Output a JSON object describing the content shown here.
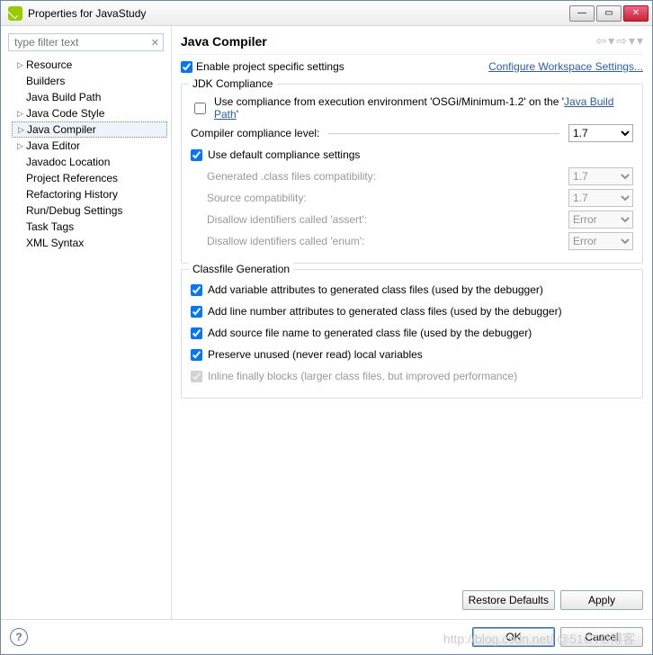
{
  "window": {
    "title": "Properties for JavaStudy"
  },
  "filter": {
    "placeholder": "type filter text"
  },
  "tree": [
    {
      "label": "Resource",
      "arrow": "▷"
    },
    {
      "label": "Builders",
      "arrow": ""
    },
    {
      "label": "Java Build Path",
      "arrow": ""
    },
    {
      "label": "Java Code Style",
      "arrow": "▷"
    },
    {
      "label": "Java Compiler",
      "arrow": "▷",
      "selected": true
    },
    {
      "label": "Java Editor",
      "arrow": "▷"
    },
    {
      "label": "Javadoc Location",
      "arrow": ""
    },
    {
      "label": "Project References",
      "arrow": ""
    },
    {
      "label": "Refactoring History",
      "arrow": ""
    },
    {
      "label": "Run/Debug Settings",
      "arrow": ""
    },
    {
      "label": "Task Tags",
      "arrow": ""
    },
    {
      "label": "XML Syntax",
      "arrow": ""
    }
  ],
  "page": {
    "heading": "Java Compiler",
    "enable_label": "Enable project specific settings",
    "enable_checked": true,
    "configure_link": "Configure Workspace Settings..."
  },
  "jdk": {
    "title": "JDK Compliance",
    "use_ee_prefix": "Use compliance from execution environment 'OSGi/Minimum-1.2' on the '",
    "use_ee_link": "Java Build Path",
    "use_ee_suffix": "'",
    "use_ee_checked": false,
    "level_label": "Compiler compliance level:",
    "level_value": "1.7",
    "use_default_label": "Use default compliance settings",
    "use_default_checked": true,
    "gen_label": "Generated .class files compatibility:",
    "gen_value": "1.7",
    "src_label": "Source compatibility:",
    "src_value": "1.7",
    "assert_label": "Disallow identifiers called 'assert':",
    "assert_value": "Error",
    "enum_label": "Disallow identifiers called 'enum':",
    "enum_value": "Error"
  },
  "classfile": {
    "title": "Classfile Generation",
    "var_label": "Add variable attributes to generated class files (used by the debugger)",
    "line_label": "Add line number attributes to generated class files (used by the debugger)",
    "src_label": "Add source file name to generated class file (used by the debugger)",
    "preserve_label": "Preserve unused (never read) local variables",
    "inline_label": "Inline finally blocks (larger class files, but improved performance)",
    "var_checked": true,
    "line_checked": true,
    "src_checked": true,
    "preserve_checked": true,
    "inline_checked": true
  },
  "buttons": {
    "restore": "Restore Defaults",
    "apply": "Apply",
    "ok": "OK",
    "cancel": "Cancel"
  },
  "watermark": "http://blog.csdn.net/  @51CTO博客"
}
